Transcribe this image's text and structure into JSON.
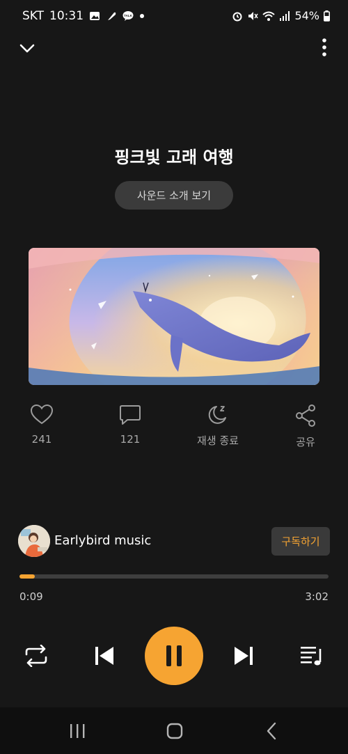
{
  "status_bar": {
    "carrier": "SKT",
    "time": "10:31",
    "left_icons": [
      "gallery-icon",
      "feather-icon",
      "kakaotalk-icon",
      "dot-icon"
    ],
    "right_icons": [
      "alarm-icon",
      "mute-icon",
      "wifi-icon",
      "signal-icon"
    ],
    "battery": "54%"
  },
  "header": {
    "collapse_icon": "chevron-down-icon",
    "menu_icon": "more-vert-icon"
  },
  "track": {
    "title": "핑크빛 고래 여행",
    "intro_button": "사운드 소개 보기"
  },
  "actions": {
    "like_count": "241",
    "comment_count": "121",
    "sleep_label": "재생 종료",
    "share_label": "공유"
  },
  "channel": {
    "name": "Earlybird music",
    "subscribe_label": "구독하기"
  },
  "playback": {
    "current_time": "0:09",
    "total_time": "3:02",
    "progress": 0.05
  },
  "colors": {
    "accent": "#f6a432",
    "background": "#171717"
  }
}
